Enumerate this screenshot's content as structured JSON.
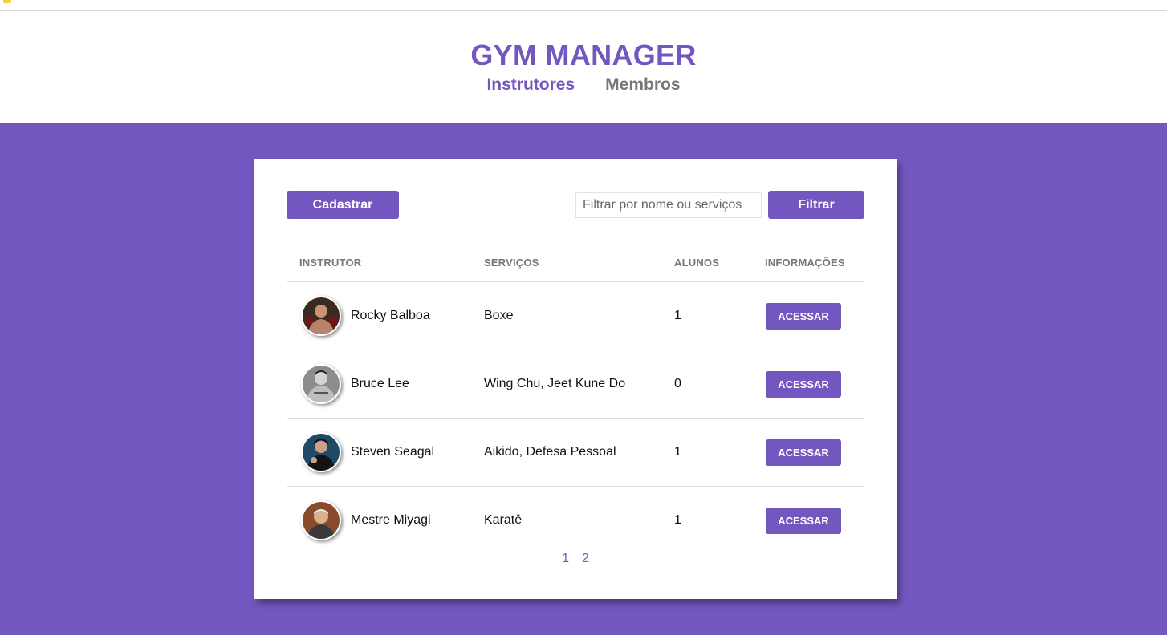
{
  "header": {
    "brand": "GYM MANAGER",
    "nav": [
      {
        "label": "Instrutores",
        "active": true
      },
      {
        "label": "Membros",
        "active": false
      }
    ]
  },
  "toolbar": {
    "new_label": "Cadastrar",
    "search_placeholder": "Filtrar por nome ou serviços",
    "search_value": "",
    "filter_label": "Filtrar"
  },
  "table": {
    "columns": [
      "INSTRUTOR",
      "SERVIÇOS",
      "ALUNOS",
      "INFORMAÇÕES"
    ],
    "rows": [
      {
        "name": "Rocky Balboa",
        "services": "Boxe",
        "students": "1",
        "action": "ACESSAR",
        "avatar": "rocky-balboa-avatar"
      },
      {
        "name": "Bruce Lee",
        "services": "Wing Chu, Jeet Kune Do",
        "students": "0",
        "action": "ACESSAR",
        "avatar": "bruce-lee-avatar"
      },
      {
        "name": "Steven Seagal",
        "services": "Aikido, Defesa Pessoal",
        "students": "1",
        "action": "ACESSAR",
        "avatar": "steven-seagal-avatar"
      },
      {
        "name": "Mestre Miyagi",
        "services": "Karatê",
        "students": "1",
        "action": "ACESSAR",
        "avatar": "mestre-miyagi-avatar"
      }
    ]
  },
  "pagination": {
    "pages": [
      "1",
      "2"
    ]
  },
  "colors": {
    "accent": "#7357c0",
    "background": "#7357c0",
    "muted": "#777777"
  }
}
